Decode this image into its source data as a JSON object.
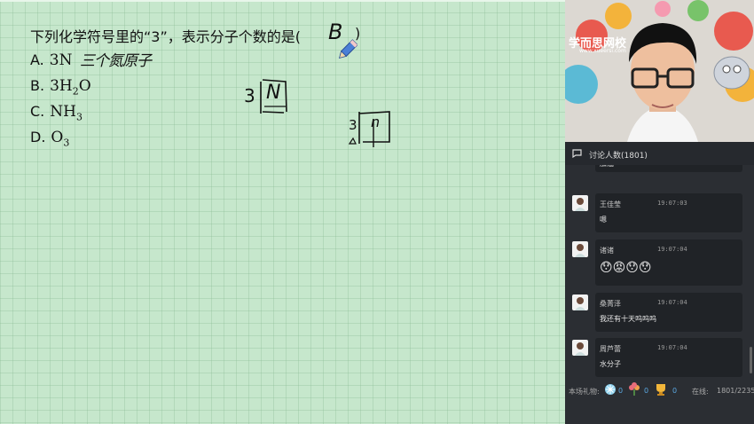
{
  "question": {
    "stem_before": "下列化学符号里的“3”，表示分子个数的是(",
    "answer": "B",
    "stem_after": ")"
  },
  "options": [
    {
      "letter": "A.",
      "formula": "3N",
      "note": "三个氮原子"
    },
    {
      "letter": "B.",
      "formula_parts": [
        "3H",
        "2",
        "O"
      ]
    },
    {
      "letter": "C.",
      "formula_parts": [
        "NH",
        "3"
      ]
    },
    {
      "letter": "D.",
      "formula_parts": [
        "O",
        "3"
      ]
    }
  ],
  "annotations": {
    "box1_coef": "3",
    "box1_symbol": "N",
    "box2_coef": "3",
    "box2_symbol": "n"
  },
  "video": {
    "school_logo": "学而思网校",
    "school_sub": "www.xueersi.com"
  },
  "chat": {
    "header": "讨论人数(1801)",
    "top_partial": "加油",
    "messages": [
      {
        "name": "王佳莹",
        "time": "19:07:03",
        "text": "嗯"
      },
      {
        "name": "诸诸",
        "time": "19:07:04",
        "emojis": [
          "😯",
          "😡",
          "😯",
          "😯"
        ]
      },
      {
        "name": "桑菁泽",
        "time": "19:07:04",
        "text": "我还有十天呜呜呜"
      },
      {
        "name": "周芦蕾",
        "time": "19:07:04",
        "text": "水分子"
      }
    ]
  },
  "footer": {
    "gifts_label": "本场礼物:",
    "gift_counts": [
      "0",
      "0",
      "0"
    ],
    "online_label": "在线:",
    "online_value": "1801/2235"
  },
  "colors": {
    "board": "#c6e7cc",
    "chat_bg": "#2b2e33",
    "bubble": "#202327"
  }
}
